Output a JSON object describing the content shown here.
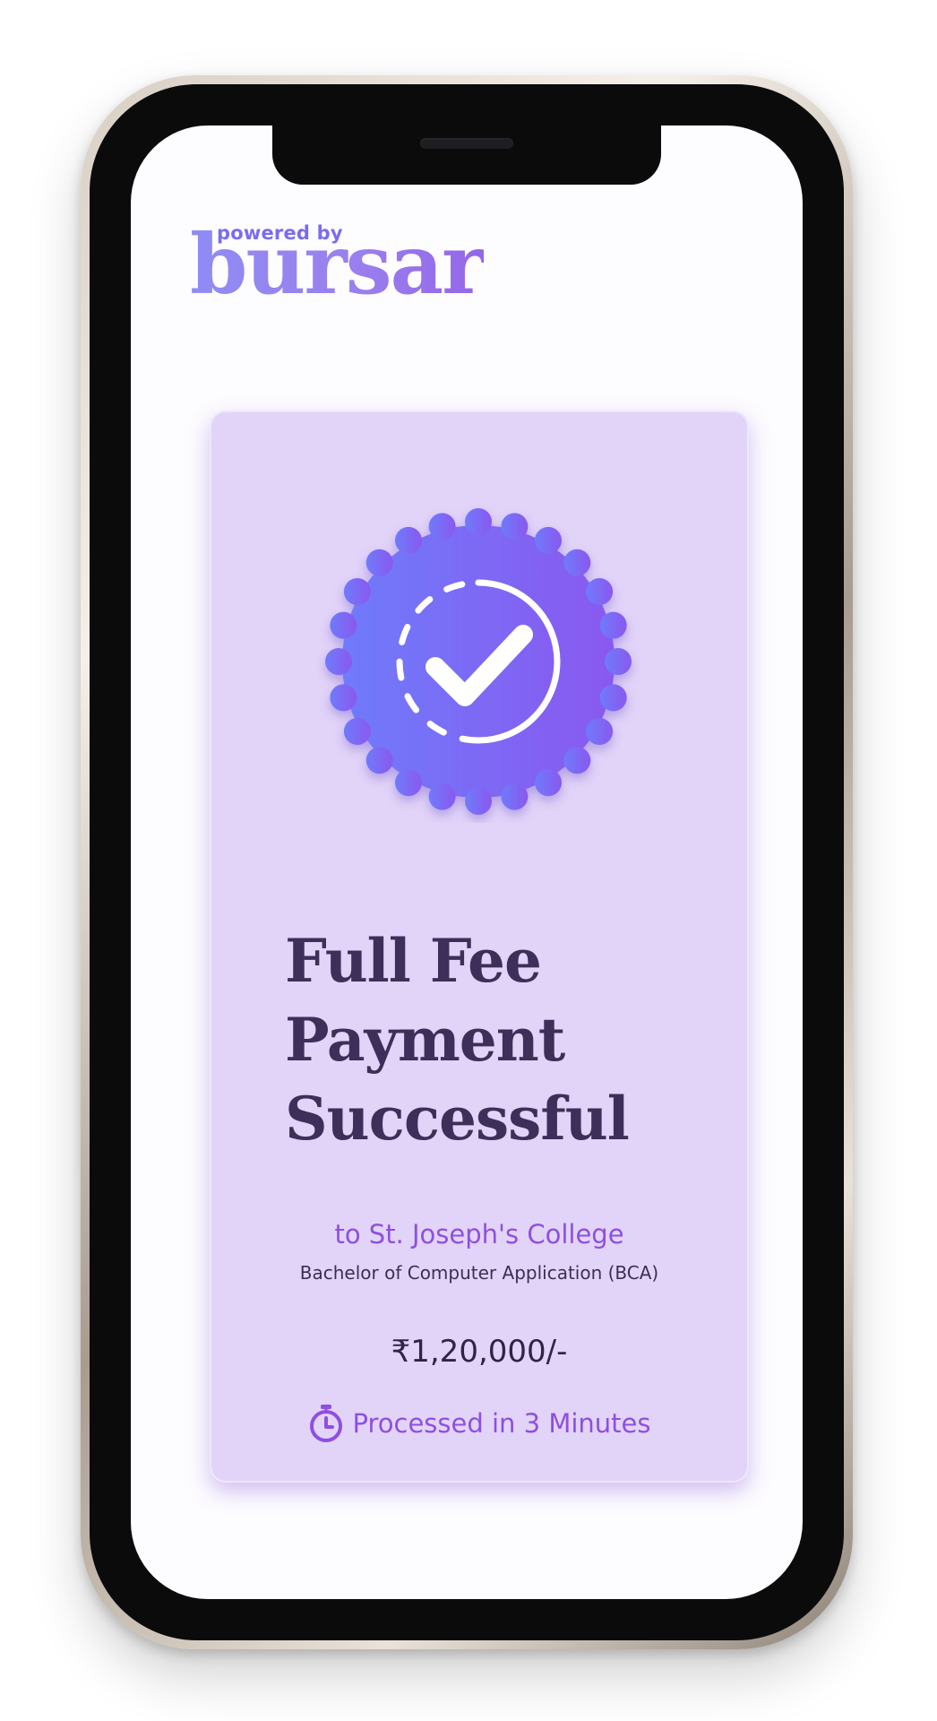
{
  "brand": {
    "powered_by": "powered by",
    "name": "bursar"
  },
  "card": {
    "badge_icon": "verified-check-badge-icon",
    "title": "Full Fee Payment Successful",
    "college": "to St. Joseph's College",
    "course": "Bachelor of Computer Application (BCA)",
    "amount": "₹1,20,000/-",
    "processed_icon": "stopwatch-icon",
    "processed": "Processed in 3 Minutes"
  },
  "colors": {
    "card_background": "#e2d4f8",
    "accent_purple": "#8e4fe2",
    "badge_gradient_start": "#6f7bfb",
    "badge_gradient_end": "#8a58ef",
    "title_text": "#3e2e5a"
  }
}
